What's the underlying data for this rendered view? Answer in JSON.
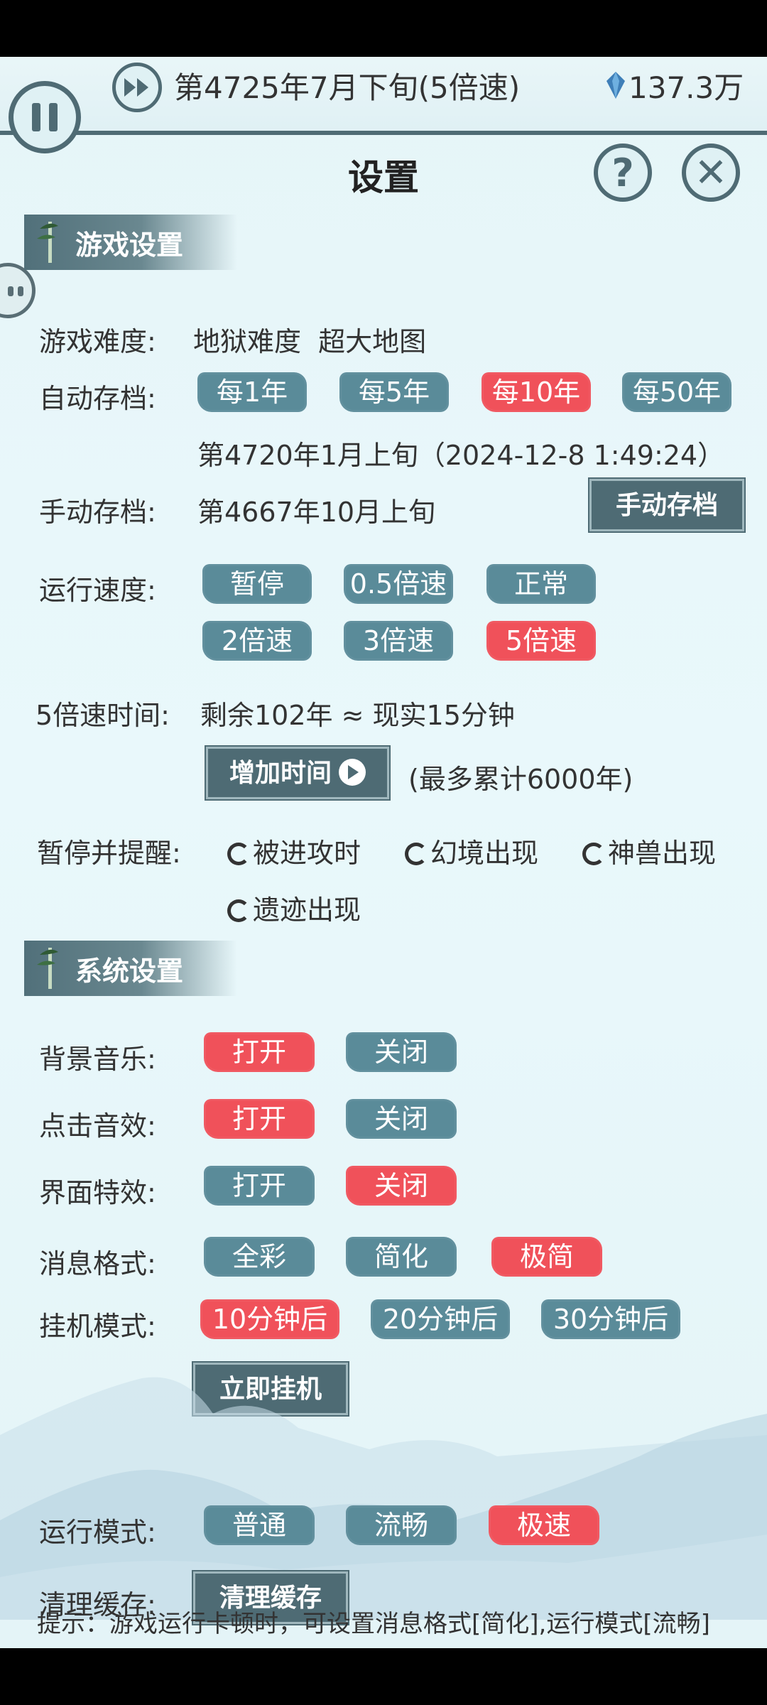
{
  "topbar": {
    "date": "第4725年7月下旬(5倍速)",
    "currency": "137.3万",
    "accent": "#4f6b74"
  },
  "title": "设置",
  "game_settings": {
    "header": "游戏设置",
    "difficulty_label": "游戏难度:",
    "difficulty_value": "地狱难度  超大地图",
    "autosave_label": "自动存档:",
    "autosave_options": [
      "每1年",
      "每5年",
      "每10年",
      "每50年"
    ],
    "autosave_selected": "每10年",
    "autosave_info": "第4720年1月上旬（2024-12-8 1:49:24）",
    "manualsave_label": "手动存档:",
    "manualsave_value": "第4667年10月上旬",
    "manualsave_button": "手动存档",
    "speed_label": "运行速度:",
    "speed_options": [
      "暂停",
      "0.5倍速",
      "正常",
      "2倍速",
      "3倍速",
      "5倍速"
    ],
    "speed_selected": "5倍速",
    "speed_time_label": "5倍速时间:",
    "speed_time_value": "剩余102年 ≈ 现实15分钟",
    "add_time_button": "增加时间",
    "add_time_note": "(最多累计6000年)",
    "pause_label": "暂停并提醒:",
    "pause_options": [
      "被进攻时",
      "幻境出现",
      "神兽出现",
      "遗迹出现"
    ]
  },
  "system_settings": {
    "header": "系统设置",
    "bgm_label": "背景音乐:",
    "bgm_options": [
      "打开",
      "关闭"
    ],
    "bgm_selected": "打开",
    "click_label": "点击音效:",
    "click_options": [
      "打开",
      "关闭"
    ],
    "click_selected": "打开",
    "fx_label": "界面特效:",
    "fx_options": [
      "打开",
      "关闭"
    ],
    "fx_selected": "关闭",
    "msg_label": "消息格式:",
    "msg_options": [
      "全彩",
      "简化",
      "极简"
    ],
    "msg_selected": "极简",
    "idle_label": "挂机模式:",
    "idle_options": [
      "10分钟后",
      "20分钟后",
      "30分钟后"
    ],
    "idle_selected": "10分钟后",
    "idle_now_button": "立即挂机",
    "run_label": "运行模式:",
    "run_options": [
      "普通",
      "流畅",
      "极速"
    ],
    "run_selected": "极速",
    "cache_label": "清理缓存:",
    "cache_button": "清理缓存"
  },
  "tip": "提示：游戏运行卡顿时，可设置消息格式[简化],运行模式[流畅]",
  "colors": {
    "chip": "#5a8b99",
    "chip_selected": "#f0515a",
    "button": "#4e6b74"
  }
}
